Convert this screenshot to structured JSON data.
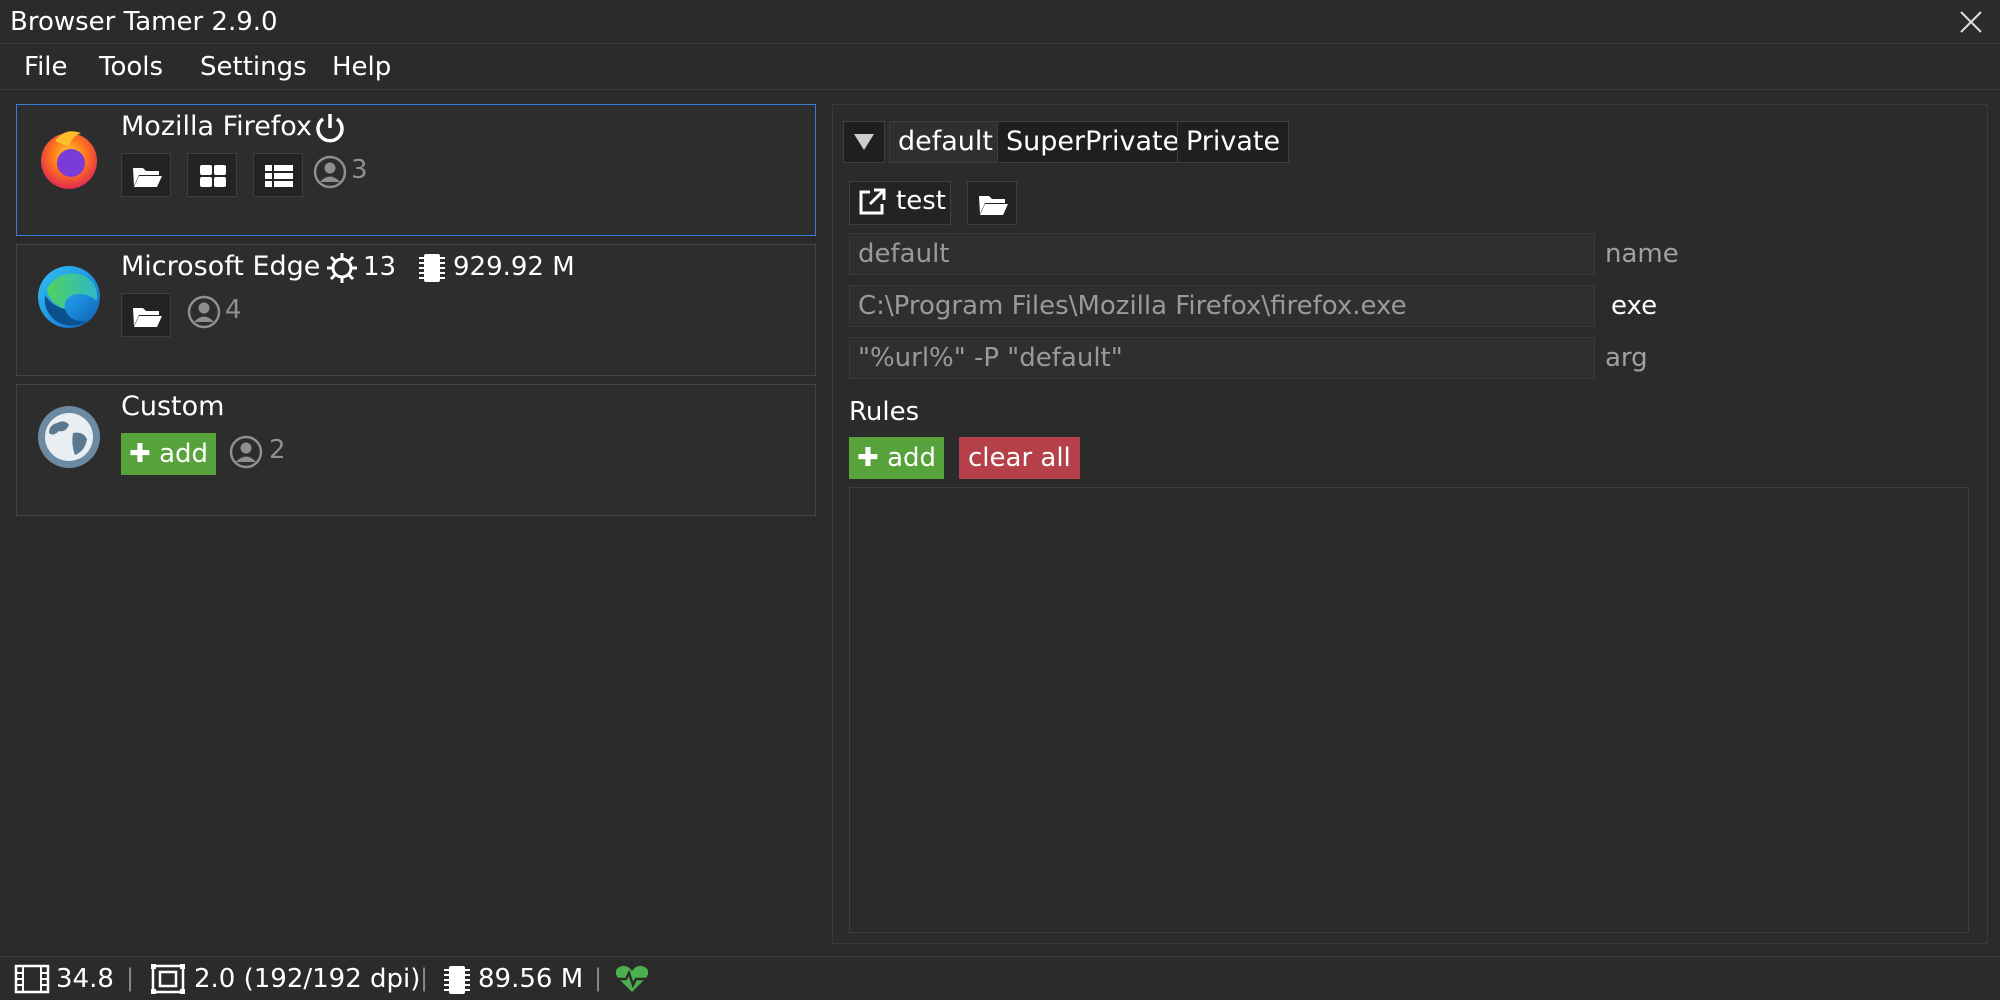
{
  "window": {
    "title": "Browser Tamer 2.9.0"
  },
  "menu": [
    "File",
    "Tools",
    "Settings",
    "Help"
  ],
  "browsers": [
    {
      "name": "Mozilla Firefox",
      "profiles_count": "3"
    },
    {
      "name": "Microsoft Edge",
      "processes": "13",
      "memory": "929.92 M",
      "profiles_count": "4"
    },
    {
      "name": "Custom",
      "add_label": "add",
      "profiles_count": "2"
    }
  ],
  "profile_tabs": [
    "default",
    "SuperPrivate",
    "Private"
  ],
  "actions": {
    "test_label": "test"
  },
  "fields": {
    "name": {
      "value": "default",
      "label": "name"
    },
    "exe": {
      "value": "C:\\Program Files\\Mozilla Firefox\\firefox.exe",
      "label": "exe"
    },
    "arg": {
      "value": "\"%url%\" -P \"default\"",
      "label": "arg"
    }
  },
  "rules": {
    "heading": "Rules",
    "add_label": "add",
    "clear_label": "clear all"
  },
  "status": {
    "fps": "34.8",
    "scale": "2.0 (192/192 dpi)",
    "memory": "89.56 M"
  },
  "colors": {
    "accent_green": "#57a23a",
    "danger_red": "#b5404a",
    "selection_blue": "#3a7bd5",
    "health_green": "#4caf50"
  }
}
